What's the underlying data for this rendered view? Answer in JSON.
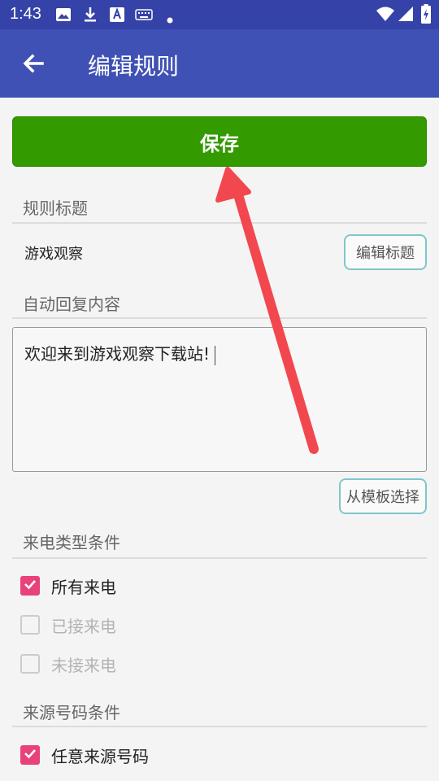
{
  "status_bar": {
    "time": "1:43"
  },
  "app_bar": {
    "title": "编辑规则"
  },
  "save_button": {
    "label": "保存"
  },
  "rule_title": {
    "section_label": "规则标题",
    "value": "游戏观察",
    "edit_button": "编辑标题"
  },
  "auto_reply": {
    "section_label": "自动回复内容",
    "text": "欢迎来到游戏观察下载站!",
    "template_button": "从模板选择"
  },
  "call_type": {
    "section_label": "来电类型条件",
    "options": [
      {
        "label": "所有来电",
        "checked": true
      },
      {
        "label": "已接来电",
        "checked": false
      },
      {
        "label": "未接来电",
        "checked": false
      }
    ]
  },
  "source_number": {
    "section_label": "来源号码条件",
    "options": [
      {
        "label": "任意来源号码",
        "checked": true
      }
    ]
  },
  "colors": {
    "app_bar": "#3f51b5",
    "status_bar": "#3543a8",
    "save_button": "#339a00",
    "checkbox_checked": "#e9417b",
    "annotation_arrow": "#f2474e"
  },
  "icons": [
    "image-icon",
    "download-icon",
    "font-icon",
    "keyboard-icon",
    "dot-icon",
    "wifi-icon",
    "signal-icon",
    "battery-icon",
    "back-arrow-icon",
    "check-icon"
  ]
}
